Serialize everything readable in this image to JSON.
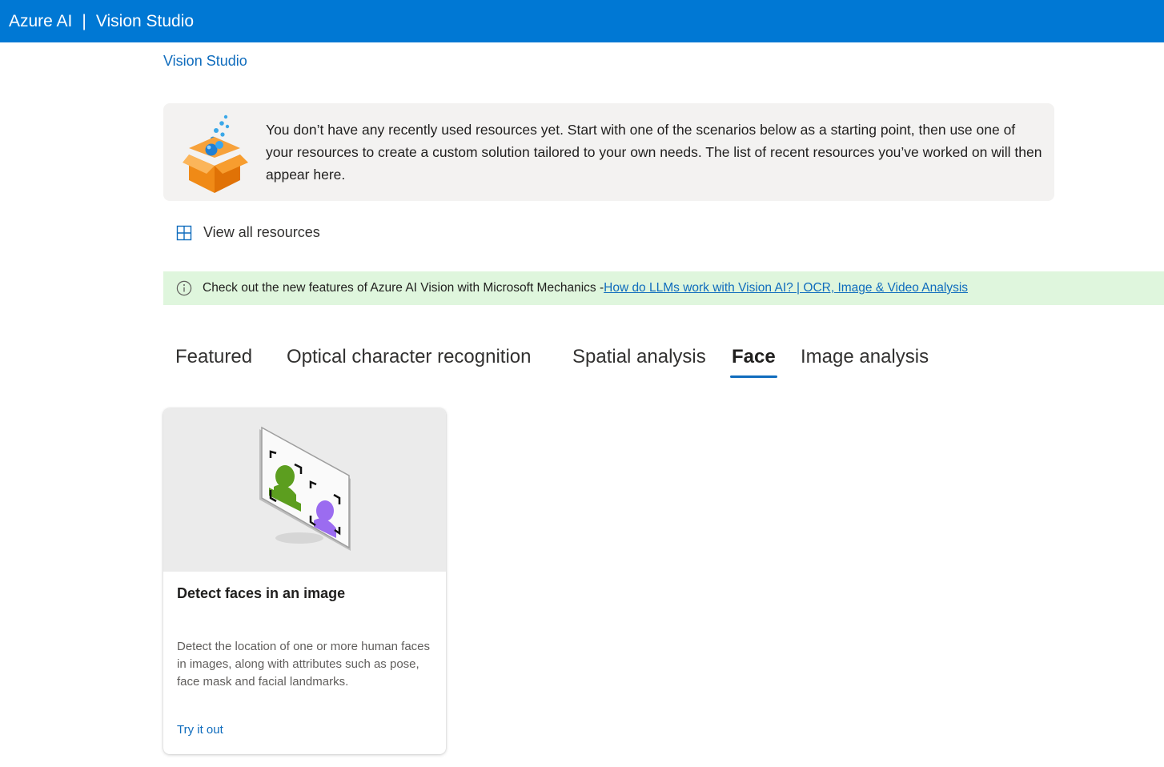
{
  "header": {
    "brand": "Azure AI",
    "separator": "|",
    "product": "Vision Studio"
  },
  "breadcrumb": {
    "label": "Vision Studio"
  },
  "recent_resources": {
    "message": "You don’t have any recently used resources yet. Start with one of the scenarios below as a starting point, then use one of your resources to create a custom solution tailored to your own needs. The list of recent resources you’ve worked on will then appear here.",
    "illustration_icon": "open-box-icon"
  },
  "view_all": {
    "label": "View all resources",
    "icon": "grid-icon"
  },
  "notice": {
    "text": "Check out the new features of Azure AI Vision with Microsoft Mechanics - ",
    "link_text": "How do LLMs work with Vision AI? | OCR, Image & Video Analysis",
    "icon": "info-icon"
  },
  "tabs": [
    {
      "label": "Featured",
      "active": false
    },
    {
      "label": "Optical character recognition",
      "active": false
    },
    {
      "label": "Spatial analysis",
      "active": false
    },
    {
      "label": "Face",
      "active": true
    },
    {
      "label": "Image analysis",
      "active": false
    }
  ],
  "cards": [
    {
      "title": "Detect faces in an image",
      "description": "Detect the location of one or more human faces in images, along with attributes such as pose, face mask and facial landmarks.",
      "action": "Try it out",
      "icon": "face-detection-icon"
    }
  ],
  "colors": {
    "header_bg": "#0078d4",
    "link": "#0f6cbd",
    "notice_bg": "#dff6dd",
    "info_card_bg": "#f3f2f1",
    "face_green": "#5c9e1f",
    "face_purple": "#9b6cf0"
  }
}
